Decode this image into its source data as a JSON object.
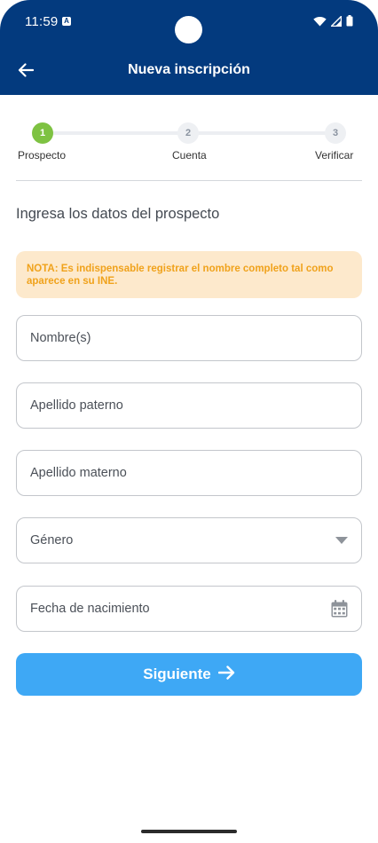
{
  "status_bar": {
    "time": "11:59",
    "notification_letter": "A",
    "icons": [
      "wifi-icon",
      "signal-icon",
      "battery-icon"
    ]
  },
  "app_bar": {
    "title": "Nueva inscripción",
    "back_icon": "arrow-left-icon"
  },
  "stepper": {
    "steps": [
      {
        "number": "1",
        "label": "Prospecto",
        "state": "active"
      },
      {
        "number": "2",
        "label": "Cuenta",
        "state": "inactive"
      },
      {
        "number": "3",
        "label": "Verificar",
        "state": "inactive"
      }
    ]
  },
  "form": {
    "title": "Ingresa los datos del prospecto",
    "note": "NOTA: Es indispensable registrar el nombre completo tal como aparece en su INE.",
    "fields": [
      {
        "placeholder": "Nombre(s)",
        "value": ""
      },
      {
        "placeholder": "Apellido paterno",
        "value": ""
      },
      {
        "placeholder": "Apellido materno",
        "value": ""
      },
      {
        "placeholder": "Género",
        "value": "",
        "icon": "dropdown-triangle-icon"
      },
      {
        "placeholder": "Fecha de nacimiento",
        "value": "",
        "icon": "calendar-icon"
      }
    ],
    "submit_label": "Siguiente",
    "submit_icon": "arrow-right-icon"
  },
  "colors": {
    "header_bg": "#033a7e",
    "step_active": "#7ec242",
    "note_bg": "#fde9cc",
    "note_text": "#f0a21b",
    "button_bg": "#3ea8f5"
  }
}
